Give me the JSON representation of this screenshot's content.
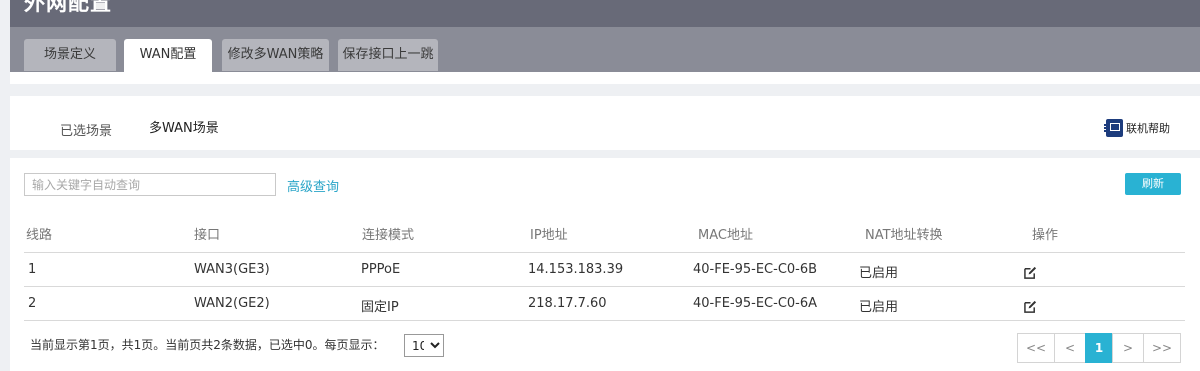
{
  "header": {
    "title": "外网配置",
    "tabs": [
      {
        "label": "场景定义"
      },
      {
        "label": "WAN配置"
      },
      {
        "label": "修改多WAN策略"
      },
      {
        "label": "保存接口上一跳"
      }
    ]
  },
  "subtabs": {
    "selected_scene": "已选场景",
    "multi_wan_scene": "多WAN场景"
  },
  "help": {
    "label": "联机帮助"
  },
  "toolbar": {
    "search_placeholder": "输入关键字自动查询",
    "advanced_query": "高级查询",
    "refresh": "刷新"
  },
  "table": {
    "headers": [
      "线路",
      "接口",
      "连接模式",
      "IP地址",
      "MAC地址",
      "NAT地址转换",
      "操作"
    ],
    "rows": [
      {
        "line": "1",
        "interface": "WAN3(GE3)",
        "mode": "PPPoE",
        "ip": "14.153.183.39",
        "mac": "40-FE-95-EC-C0-6B",
        "nat": "已启用"
      },
      {
        "line": "2",
        "interface": "WAN2(GE2)",
        "mode": "固定IP",
        "ip": "218.17.7.60",
        "mac": "40-FE-95-EC-C0-6A",
        "nat": "已启用"
      }
    ]
  },
  "footer": {
    "summary": "当前显示第1页，共1页。当前页共2条数据，已选中0。每页显示：",
    "page_size": "10"
  },
  "pager": {
    "first": "<<",
    "prev": "<",
    "current": "1",
    "next": ">",
    "last": ">>"
  },
  "colors": {
    "header_bg": "#686a78",
    "accent": "#29b2d3",
    "link": "#2aa5c8"
  }
}
